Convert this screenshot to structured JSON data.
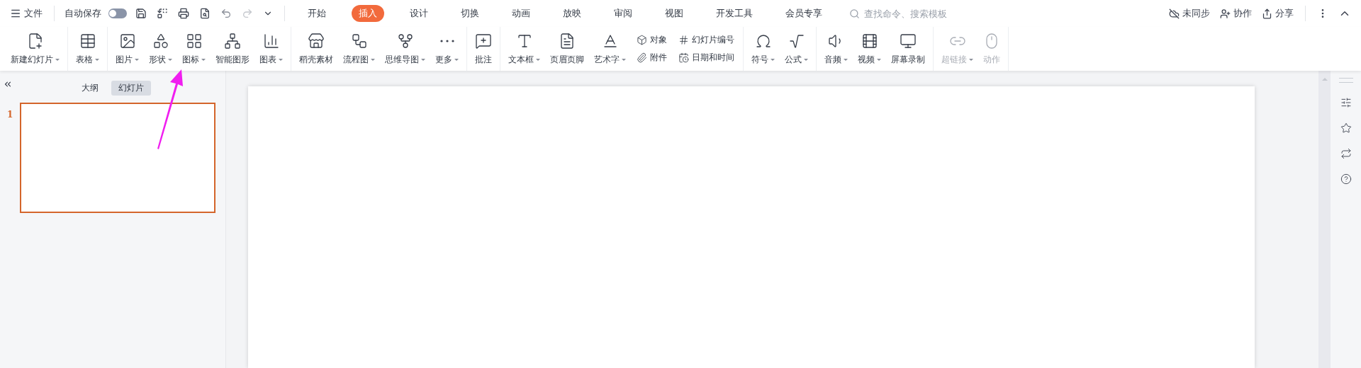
{
  "quick_bar": {
    "file_menu": "文件",
    "autosave": {
      "label": "自动保存",
      "on": false
    }
  },
  "menu_tabs": [
    {
      "label": "开始",
      "selected": false
    },
    {
      "label": "插入",
      "selected": true
    },
    {
      "label": "设计",
      "selected": false
    },
    {
      "label": "切换",
      "selected": false
    },
    {
      "label": "动画",
      "selected": false
    },
    {
      "label": "放映",
      "selected": false
    },
    {
      "label": "审阅",
      "selected": false
    },
    {
      "label": "视图",
      "selected": false
    },
    {
      "label": "开发工具",
      "selected": false
    },
    {
      "label": "会员专享",
      "selected": false
    }
  ],
  "search": {
    "placeholder": "查找命令、搜索模板"
  },
  "account_actions": [
    {
      "label": "未同步"
    },
    {
      "label": "协作"
    },
    {
      "label": "分享"
    }
  ],
  "ribbon": {
    "groups": [
      {
        "items": [
          {
            "kind": "big",
            "label": "新建幻灯片",
            "caret": true,
            "disabled": false
          }
        ]
      },
      {
        "items": [
          {
            "kind": "big",
            "label": "表格",
            "caret": true,
            "disabled": false
          }
        ]
      },
      {
        "items": [
          {
            "kind": "big",
            "label": "图片",
            "caret": true,
            "disabled": false
          },
          {
            "kind": "big",
            "label": "形状",
            "caret": true,
            "disabled": false
          },
          {
            "kind": "big",
            "label": "图标",
            "caret": true,
            "disabled": false
          },
          {
            "kind": "big",
            "label": "智能图形",
            "caret": false,
            "disabled": false
          },
          {
            "kind": "big",
            "label": "图表",
            "caret": true,
            "disabled": false
          }
        ]
      },
      {
        "items": [
          {
            "kind": "big",
            "label": "稻壳素材",
            "caret": false,
            "disabled": false
          },
          {
            "kind": "big",
            "label": "流程图",
            "caret": true,
            "disabled": false
          },
          {
            "kind": "big",
            "label": "思维导图",
            "caret": true,
            "disabled": false
          },
          {
            "kind": "big",
            "label": "更多",
            "caret": true,
            "disabled": false
          }
        ]
      },
      {
        "items": [
          {
            "kind": "big",
            "label": "批注",
            "caret": false,
            "disabled": false
          }
        ]
      },
      {
        "items": [
          {
            "kind": "big",
            "label": "文本框",
            "caret": true,
            "disabled": false
          },
          {
            "kind": "big",
            "label": "页眉页脚",
            "caret": false,
            "disabled": false
          },
          {
            "kind": "big",
            "label": "艺术字",
            "caret": true,
            "disabled": false
          },
          {
            "kind": "stack",
            "rows": [
              {
                "label": "对象"
              },
              {
                "label": "附件"
              }
            ]
          },
          {
            "kind": "stack",
            "rows": [
              {
                "label": "幻灯片编号"
              },
              {
                "label": "日期和时间"
              }
            ]
          }
        ]
      },
      {
        "items": [
          {
            "kind": "big",
            "label": "符号",
            "caret": true,
            "disabled": false
          },
          {
            "kind": "big",
            "label": "公式",
            "caret": true,
            "disabled": false
          }
        ]
      },
      {
        "items": [
          {
            "kind": "big",
            "label": "音频",
            "caret": true,
            "disabled": false
          },
          {
            "kind": "big",
            "label": "视频",
            "caret": true,
            "disabled": false
          },
          {
            "kind": "big",
            "label": "屏幕录制",
            "caret": false,
            "disabled": false
          }
        ]
      },
      {
        "items": [
          {
            "kind": "big",
            "label": "超链接",
            "caret": true,
            "disabled": true
          },
          {
            "kind": "big",
            "label": "动作",
            "caret": false,
            "disabled": true
          }
        ]
      }
    ]
  },
  "slide_panel": {
    "tabs": [
      {
        "label": "大纲",
        "selected": false
      },
      {
        "label": "幻灯片",
        "selected": true
      }
    ],
    "slides": [
      {
        "number": "1",
        "selected": true
      }
    ]
  }
}
